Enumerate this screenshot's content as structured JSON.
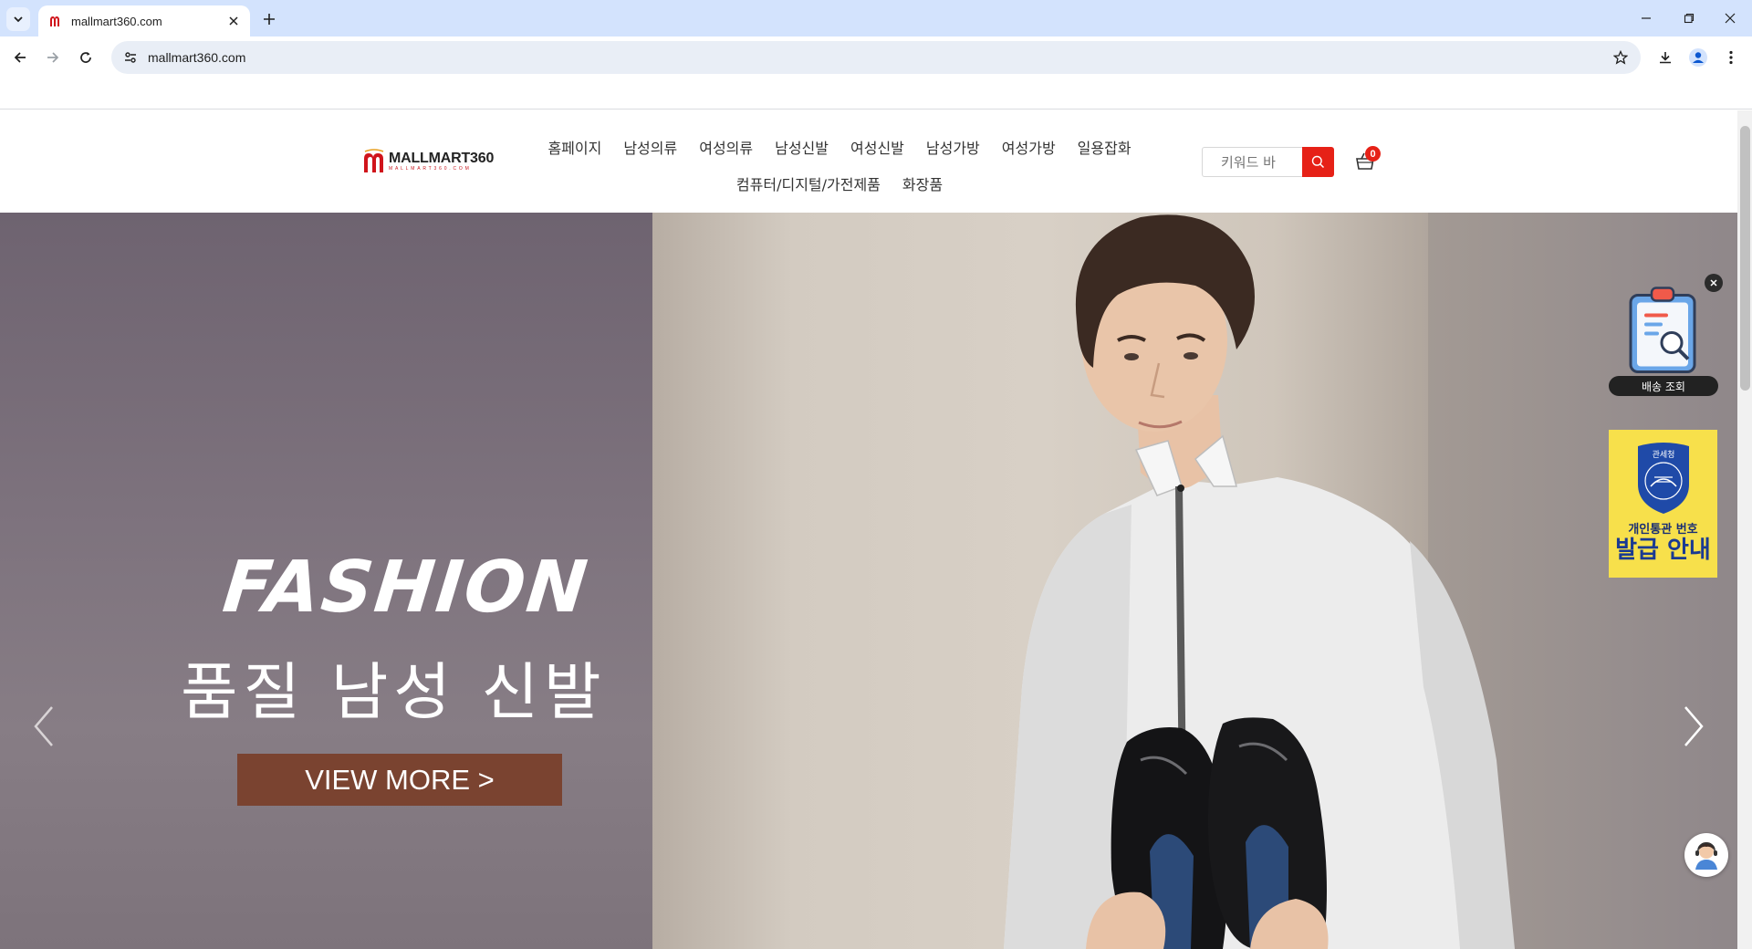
{
  "browser": {
    "tab_title": "mallmart360.com",
    "url": "mallmart360.com"
  },
  "site": {
    "logo_name": "MALLMART360",
    "logo_sub": "MALLMART360.COM",
    "brand_color": "#e62117",
    "nav_row1": [
      "홈페이지",
      "남성의류",
      "여성의류",
      "남성신발",
      "여성신발",
      "남성가방",
      "여성가방",
      "일용잡화"
    ],
    "nav_row2": [
      "컴퓨터/디지털/가전제품",
      "화장품"
    ],
    "search_placeholder": "키워드 바",
    "cart_count": "0"
  },
  "hero": {
    "title": "FASHION",
    "subtitle": "품질 남성 신발",
    "cta": "VIEW MORE >"
  },
  "floating": {
    "delivery_label": "배송 조회",
    "customs_top": "관세청",
    "customs_line1": "개인통관 번호",
    "customs_line2": "발급 안내"
  }
}
